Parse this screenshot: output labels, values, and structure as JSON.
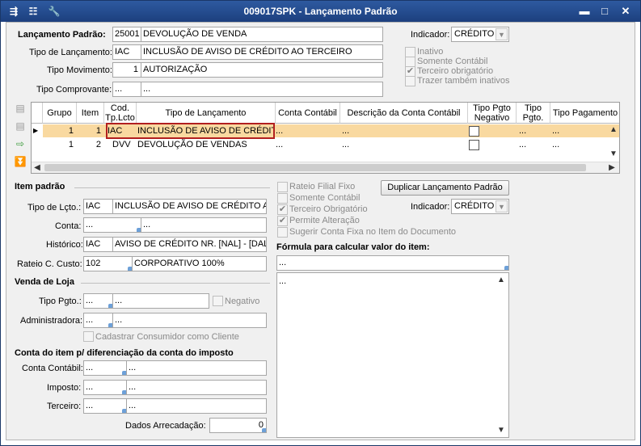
{
  "window": {
    "title": "009017SPK - Lançamento Padrão",
    "minimize": "▬",
    "maximize": "□",
    "close": "✕"
  },
  "header": {
    "lanc_padrao_label": "Lançamento Padrão:",
    "lanc_padrao_code": "25001",
    "lanc_padrao_desc": "DEVOLUÇÃO DE VENDA",
    "tipo_lanc_label": "Tipo de Lançamento:",
    "tipo_lanc_code": "IAC",
    "tipo_lanc_desc": "INCLUSÃO DE AVISO DE CRÉDITO AO TERCEIRO",
    "tipo_mov_label": "Tipo Movimento:",
    "tipo_mov_code": "1",
    "tipo_mov_desc": "AUTORIZAÇÃO",
    "tipo_comp_label": "Tipo Comprovante:",
    "tipo_comp_code": "...",
    "tipo_comp_desc": "...",
    "indicador_label": "Indicador:",
    "indicador_value": "CRÉDITO",
    "inativo": "Inativo",
    "somente_contabil": "Somente Contábil",
    "terceiro_obrigatorio": "Terceiro obrigatório",
    "trazer_inativos": "Trazer também inativos"
  },
  "grid": {
    "columns": [
      "Grupo",
      "Item",
      "Cod. Tp.Lcto",
      "Tipo de Lançamento",
      "Conta Contábil",
      "Descrição da Conta Contábil",
      "Tipo Pgto Negativo",
      "Tipo Pgto.",
      "Tipo Pagamento"
    ],
    "rows": [
      {
        "grupo": "1",
        "item": "1",
        "cod": "IAC",
        "tipo": "INCLUSÃO DE AVISO DE CRÉDITO",
        "conta": "...",
        "desc": "...",
        "pgto": "...",
        "pagamento": "..."
      },
      {
        "grupo": "1",
        "item": "2",
        "cod": "DVV",
        "tipo": "DEVOLUÇÃO DE VENDAS",
        "conta": "...",
        "desc": "...",
        "pgto": "...",
        "pagamento": "..."
      }
    ]
  },
  "item": {
    "section": "Item padrão",
    "tipo_lcto_label": "Tipo de Lçto.:",
    "tipo_lcto_code": "IAC",
    "tipo_lcto_desc": "INCLUSÃO DE AVISO DE CRÉDITO AO",
    "conta_label": "Conta:",
    "conta_code": "...",
    "conta_desc": "...",
    "historico_label": "Histórico:",
    "historico_code": "IAC",
    "historico_desc": "AVISO DE CRÉDITO NR. [NAL] - [DAL]",
    "rateio_label": "Rateio C. Custo:",
    "rateio_code": "102",
    "rateio_desc": "CORPORATIVO 100%",
    "rateio_filial": "Rateio Filial Fixo",
    "somente_contabil": "Somente Contábil",
    "terceiro_obrigatorio": "Terceiro Obrigatório",
    "permite_alteracao": "Permite Alteração",
    "sugerir_conta": "Sugerir Conta Fixa no Item do Documento",
    "duplicar_button": "Duplicar Lançamento Padrão",
    "indicador_label": "Indicador:",
    "indicador_value": "CRÉDITO",
    "formula_label": "Fórmula para calcular valor do item:",
    "formula_value": "...",
    "memo_value": "..."
  },
  "loja": {
    "section": "Venda de Loja",
    "tipo_pgto_label": "Tipo Pgto.:",
    "tipo_pgto_code": "...",
    "tipo_pgto_desc": "...",
    "negativo": "Negativo",
    "admin_label": "Administradora:",
    "admin_code": "...",
    "admin_desc": "...",
    "cadastrar": "Cadastrar Consumidor como Cliente"
  },
  "conta_imposto": {
    "section": "Conta do item p/ diferenciação da conta do imposto",
    "contabil_label": "Conta Contábil:",
    "contabil_code": "...",
    "contabil_desc": "...",
    "imposto_label": "Imposto:",
    "imposto_code": "...",
    "imposto_desc": "...",
    "terceiro_label": "Terceiro:",
    "terceiro_code": "...",
    "terceiro_desc": "...",
    "dados_label": "Dados Arrecadação:",
    "dados_value": "0"
  }
}
